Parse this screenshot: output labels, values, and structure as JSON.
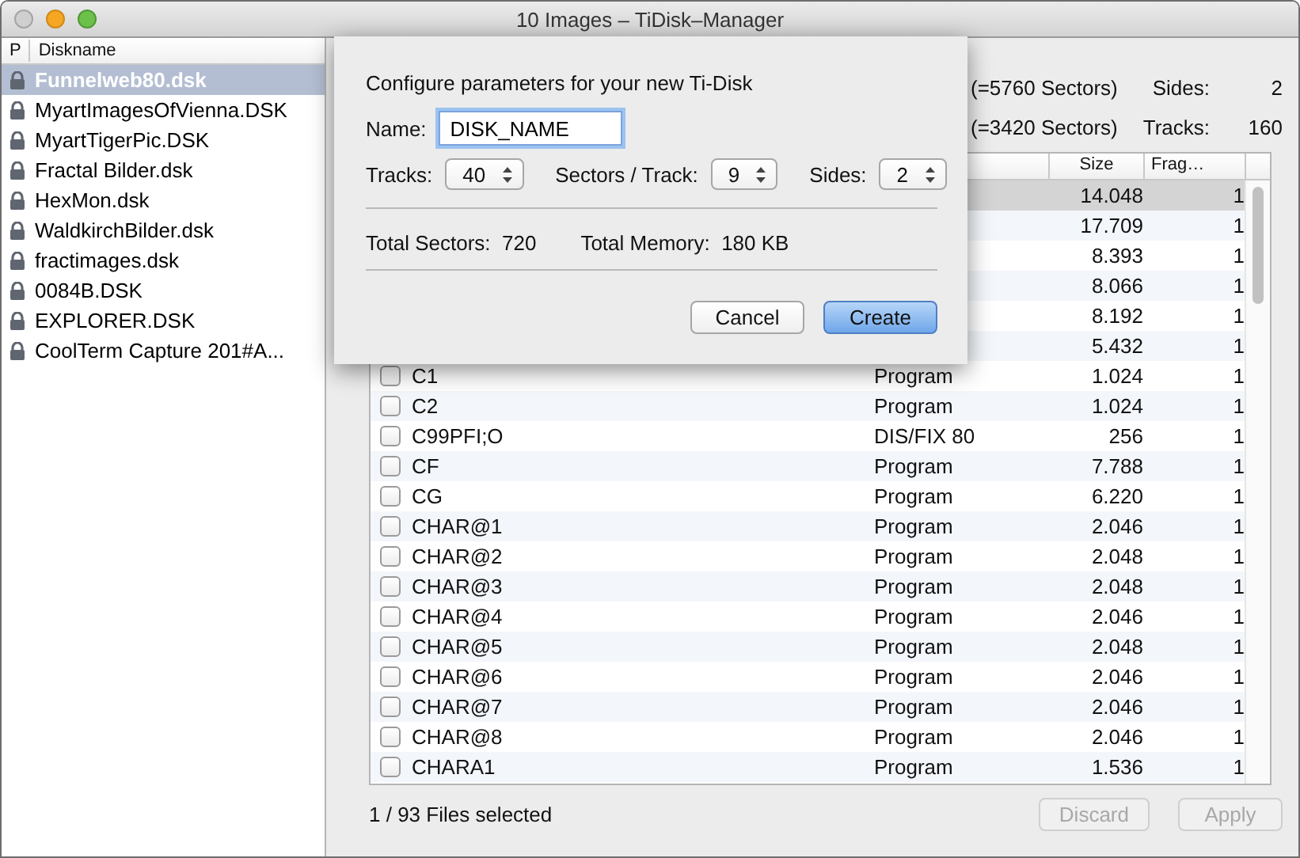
{
  "window": {
    "title": "10 Images – TiDisk–Manager"
  },
  "disk_list": {
    "columns": [
      "P",
      "Diskname"
    ],
    "items": [
      {
        "name": "Funnelweb80.dsk",
        "selected": true
      },
      {
        "name": "MyartImagesOfVienna.DSK",
        "selected": false
      },
      {
        "name": "MyartTigerPic.DSK",
        "selected": false
      },
      {
        "name": "Fractal Bilder.dsk",
        "selected": false
      },
      {
        "name": "HexMon.dsk",
        "selected": false
      },
      {
        "name": "WaldkirchBilder.dsk",
        "selected": false
      },
      {
        "name": "fractimages.dsk",
        "selected": false
      },
      {
        "name": "0084B.DSK",
        "selected": false
      },
      {
        "name": "EXPLORER.DSK",
        "selected": false
      },
      {
        "name": "CoolTerm Capture 201#A...",
        "selected": false
      }
    ]
  },
  "disk_info": [
    {
      "sectors": "(=5760 Sectors)",
      "label": "Sides:",
      "value": "2"
    },
    {
      "sectors": "(=3420 Sectors)",
      "label": "Tracks:",
      "value": "160"
    }
  ],
  "files": {
    "columns": [
      "Size",
      "Frag…"
    ],
    "rows": [
      {
        "size": "14.048",
        "frag": "1",
        "selected": true
      },
      {
        "size": "17.709",
        "frag": "1",
        "selected": false
      },
      {
        "size": "8.393",
        "frag": "1",
        "selected": false
      },
      {
        "size": "8.066",
        "frag": "1",
        "selected": false
      },
      {
        "size": "8.192",
        "frag": "1",
        "selected": false
      },
      {
        "size": "5.432",
        "frag": "1",
        "selected": false
      },
      {
        "name": "C1",
        "type": "Program",
        "size": "1.024",
        "frag": "1",
        "checked": false,
        "selected": false
      },
      {
        "name": "C2",
        "type": "Program",
        "size": "1.024",
        "frag": "1",
        "checked": false,
        "selected": false
      },
      {
        "name": "C99PFI;O",
        "type": "DIS/FIX 80",
        "size": "256",
        "frag": "1",
        "checked": false,
        "selected": false
      },
      {
        "name": "CF",
        "type": "Program",
        "size": "7.788",
        "frag": "1",
        "checked": false,
        "selected": false
      },
      {
        "name": "CG",
        "type": "Program",
        "size": "6.220",
        "frag": "1",
        "checked": false,
        "selected": false
      },
      {
        "name": "CHAR@1",
        "type": "Program",
        "size": "2.046",
        "frag": "1",
        "checked": false,
        "selected": false
      },
      {
        "name": "CHAR@2",
        "type": "Program",
        "size": "2.048",
        "frag": "1",
        "checked": false,
        "selected": false
      },
      {
        "name": "CHAR@3",
        "type": "Program",
        "size": "2.048",
        "frag": "1",
        "checked": false,
        "selected": false
      },
      {
        "name": "CHAR@4",
        "type": "Program",
        "size": "2.046",
        "frag": "1",
        "checked": false,
        "selected": false
      },
      {
        "name": "CHAR@5",
        "type": "Program",
        "size": "2.048",
        "frag": "1",
        "checked": false,
        "selected": false
      },
      {
        "name": "CHAR@6",
        "type": "Program",
        "size": "2.046",
        "frag": "1",
        "checked": false,
        "selected": false
      },
      {
        "name": "CHAR@7",
        "type": "Program",
        "size": "2.046",
        "frag": "1",
        "checked": false,
        "selected": false
      },
      {
        "name": "CHAR@8",
        "type": "Program",
        "size": "2.046",
        "frag": "1",
        "checked": false,
        "selected": false
      },
      {
        "name": "CHARA1",
        "type": "Program",
        "size": "1.536",
        "frag": "1",
        "checked": false,
        "selected": false
      }
    ]
  },
  "status": "1 / 93 Files selected",
  "buttons": [
    {
      "label": "Discard",
      "disabled": true
    },
    {
      "label": "Apply",
      "disabled": true
    }
  ],
  "dialog": {
    "heading": "Configure parameters for your new Ti-Disk",
    "name_label": "Name:",
    "name_value": "DISK_NAME",
    "steppers": [
      {
        "label": "Tracks:",
        "value": "40"
      },
      {
        "label": "Sectors / Track:",
        "value": "9"
      },
      {
        "label": "Sides:",
        "value": "2"
      }
    ],
    "totals": [
      {
        "label": "Total Sectors:",
        "value": "720"
      },
      {
        "label": "Total Memory:",
        "value": "180 KB"
      }
    ],
    "buttons": [
      {
        "label": "Cancel",
        "default": false
      },
      {
        "label": "Create",
        "default": true
      }
    ]
  }
}
